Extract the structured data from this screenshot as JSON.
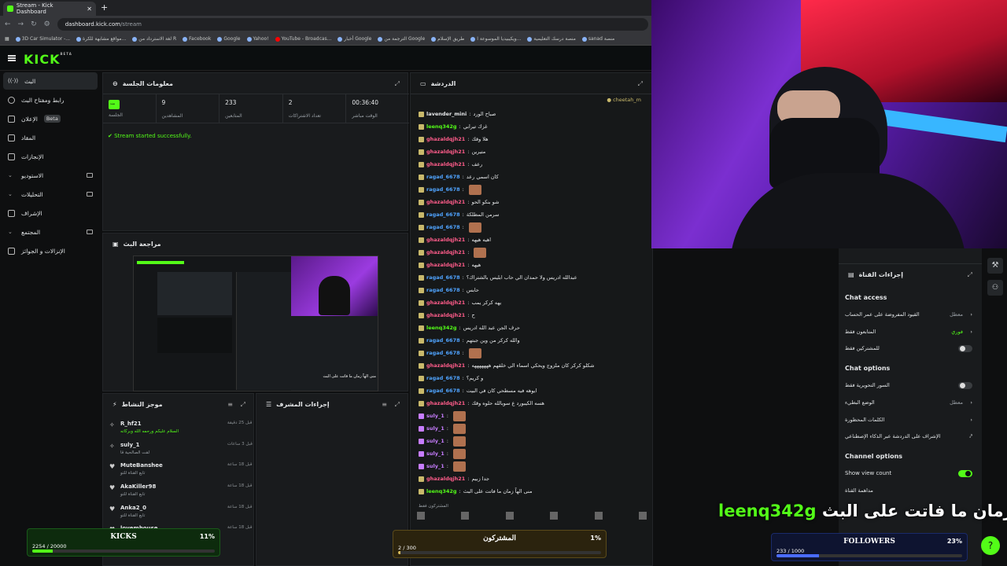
{
  "browser": {
    "tab_title": "Stream - Kick Dashboard",
    "url_host": "dashboard.kick.com",
    "url_path": "/stream",
    "bookmarks": [
      "3D Car Simulator -...",
      "مواقع مشابهة للكرة...",
      "لغة الاسترداد من R",
      "Facebook",
      "Google",
      "Yahoo!",
      "YouTube - Broadcas...",
      "أخبار Google",
      "الترجمة من Google",
      "طريق الإسلام",
      "ويكيبيديا الموسوعة ا...",
      "منصة درسك التعليمية",
      "sanad منصة"
    ]
  },
  "brand": {
    "logo": "KICK",
    "logo_tag": "BETA"
  },
  "sidebar": {
    "items": [
      {
        "label": "البث"
      },
      {
        "label": "رابط ومفتاح البث"
      },
      {
        "label": "الإعلان",
        "badge": "Beta"
      },
      {
        "label": "المقاد"
      },
      {
        "label": "الإنجازات"
      },
      {
        "label": "الاستوديو"
      },
      {
        "label": "التحليلات"
      },
      {
        "label": "الإشراف"
      },
      {
        "label": "المجتمع"
      },
      {
        "label": "الإنزالات و الجوائز"
      }
    ]
  },
  "session": {
    "title": "معلومات الجلسة",
    "live_badge": "بث",
    "stats": [
      {
        "value": "",
        "label": "الجلسة"
      },
      {
        "value": "9",
        "label": "المشاهدين"
      },
      {
        "value": "233",
        "label": "المتابعين"
      },
      {
        "value": "2",
        "label": "تعداد الاشتراكات"
      },
      {
        "value": "00:36:40",
        "label": "الوقت مباشر"
      }
    ],
    "status": "Stream started successfully."
  },
  "preview": {
    "title": "مراجعة البث"
  },
  "activity": {
    "title": "موجز النشاط",
    "items": [
      {
        "name": "R_hf21",
        "sub": "السلام عليكم ورحمه الله وبركاته",
        "when": "قبل 25 دقيقة"
      },
      {
        "name": "suly_1",
        "sub": "لقت الصالحية قا",
        "when": "قبل 3 ساعات"
      },
      {
        "name": "MuteBanshee",
        "sub": "تابع القناة للتو",
        "when": "قبل 18 ساعة"
      },
      {
        "name": "AkaKiller98",
        "sub": "تابع القناة للتو",
        "when": "قبل 18 ساعة"
      },
      {
        "name": "Anka2_0",
        "sub": "تابع القناة للتو",
        "when": "قبل 18 ساعة"
      },
      {
        "name": "lovemhouse",
        "sub": "تابع القناة للتو",
        "when": "قبل 18 ساعة"
      }
    ]
  },
  "mod_actions": {
    "title": "إجراءات المشرف"
  },
  "chat": {
    "title": "الدردشة",
    "pinned_user": "cheetah_m",
    "messages": [
      {
        "user": "lavender_mini",
        "text": "صباح الورد",
        "color": "#e5e7e9"
      },
      {
        "user": "leenq342g",
        "text": "غزك تيرابي",
        "color": "#53fc18"
      },
      {
        "user": "ghazaldqjh21",
        "text": "هلا وقك",
        "color": "#ff5c8a"
      },
      {
        "user": "ghazaldqjh21",
        "text": "متيرين",
        "color": "#ff5c8a"
      },
      {
        "user": "ghazaldqjh21",
        "text": "رعف",
        "color": "#ff5c8a"
      },
      {
        "user": "ragad_6678",
        "text": "كان اسمي رعد",
        "color": "#4fa3ff"
      },
      {
        "user": "ragad_6678",
        "text": "",
        "color": "#4fa3ff"
      },
      {
        "user": "ghazaldqjh21",
        "text": "شو بنكو الحو",
        "color": "#ff5c8a"
      },
      {
        "user": "ragad_6678",
        "text": "سرمن المطلكة",
        "color": "#4fa3ff"
      },
      {
        "user": "ragad_6678",
        "text": "",
        "color": "#4fa3ff"
      },
      {
        "user": "ghazaldqjh21",
        "text": "اهيه هيهه",
        "color": "#ff5c8a"
      },
      {
        "user": "ghazaldqjh21",
        "text": "",
        "color": "#ff5c8a"
      },
      {
        "user": "ghazaldqjh21",
        "text": "هيهه",
        "color": "#ff5c8a"
      },
      {
        "user": "ragad_6678",
        "text": "عبدالله ادريس ولا حمدان الي حاب ابليس بالشتراك؟",
        "color": "#4fa3ff"
      },
      {
        "user": "ragad_6678",
        "text": "حابس",
        "color": "#4fa3ff"
      },
      {
        "user": "ghazaldqjh21",
        "text": "يهه كركر يمب",
        "color": "#ff5c8a"
      },
      {
        "user": "ghazaldqjh21",
        "text": "ح",
        "color": "#ff5c8a"
      },
      {
        "user": "leenq342g",
        "text": "حرف الجن عبد الله ادريس",
        "color": "#53fc18"
      },
      {
        "user": "ragad_6678",
        "text": "والله كركر من وين جبتهم",
        "color": "#4fa3ff"
      },
      {
        "user": "ragad_6678",
        "text": "",
        "color": "#4fa3ff"
      },
      {
        "user": "ghazaldqjh21",
        "text": "شكلو كركر كان ملزوج ويحكي اسماء الي خلقهم هههههههه",
        "color": "#ff5c8a"
      },
      {
        "user": "ragad_6678",
        "text": "و كريم؟",
        "color": "#4fa3ff"
      },
      {
        "user": "ragad_6678",
        "text": "ايوهه فيه مسطحي كان في البيت",
        "color": "#4fa3ff"
      },
      {
        "user": "ghazaldqjh21",
        "text": "هسه الكيبورد ع سوبالله حلوه وقك",
        "color": "#ff5c8a"
      },
      {
        "user": "suly_1",
        "text": "",
        "color": "#c77dff"
      },
      {
        "user": "suly_1",
        "text": "",
        "color": "#c77dff"
      },
      {
        "user": "suly_1",
        "text": "",
        "color": "#c77dff"
      },
      {
        "user": "suly_1",
        "text": "",
        "color": "#c77dff"
      },
      {
        "user": "suly_1",
        "text": "",
        "color": "#c77dff"
      },
      {
        "user": "ghazaldqjh21",
        "text": "جدا زبيم",
        "color": "#ff5c8a"
      },
      {
        "user": "leenq342g",
        "text": "منى الهاً زمان ما فاتت على البث",
        "color": "#53fc18"
      }
    ],
    "footer": "المشتركون فقط"
  },
  "channel_actions": {
    "title": "إجراءات القناة",
    "chat_access_head": "Chat access",
    "chat_access": [
      {
        "label": "القيود المفروضة على عمر الحساب",
        "value": "معطل"
      },
      {
        "label": "المتابعون فقط",
        "value": "فوري"
      },
      {
        "label": "للمشتركين فقط",
        "value": ""
      }
    ],
    "chat_options_head": "Chat options",
    "chat_options": [
      {
        "label": "السور التحويرية فقط",
        "value": ""
      },
      {
        "label": "الوضع البطيء",
        "value": "معطل"
      },
      {
        "label": "الكلمات المحظورة",
        "value": ""
      },
      {
        "label": "الإشراف على الدردشة عبر الذكاء الإصطناعي",
        "value": ""
      }
    ],
    "channel_options_head": "Channel options",
    "channel_options": [
      {
        "label": "Show view count"
      },
      {
        "label": "مداهمة القناة"
      }
    ]
  },
  "overlays": {
    "kicks": {
      "title": "KICKS",
      "percent": "11%",
      "count": "2254 / 20000",
      "fill": 0.11
    },
    "subs": {
      "title": "المشتركون",
      "percent": "1%",
      "count": "2 / 300",
      "fill": 0.01
    },
    "followers": {
      "title": "FOLLOWERS",
      "percent": "23%",
      "count": "233 / 1000",
      "fill": 0.23
    },
    "caption_user": "leenq342g",
    "caption_text": "منى الهاً زمان ما فاتت على البث",
    "preview_caption": "منى الهاً زمان ما فاتت على البث"
  },
  "colors": {
    "accent": "#53fc18",
    "panel": "#191b1d",
    "bg": "#0e0f10"
  }
}
